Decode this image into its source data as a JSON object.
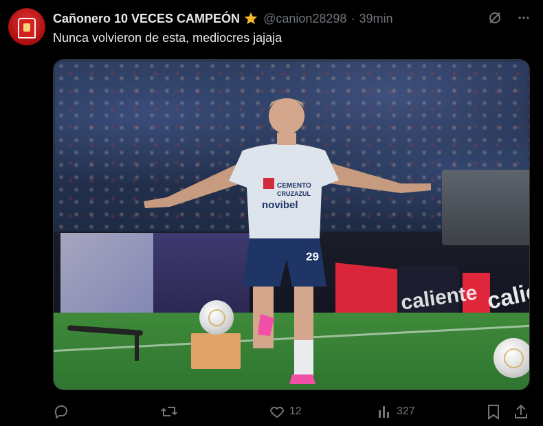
{
  "author": {
    "display_name": "Cañonero 10 VECES CAMPEÓN",
    "handle": "@canion28298",
    "separator": "·",
    "time": "39min",
    "badge_icon": "star-icon",
    "badge_color": "#f7b928"
  },
  "tweet": {
    "text": "Nunca volvieron de esta, mediocres jajaja"
  },
  "media": {
    "shirt_sponsor_1": "CEMENTO",
    "shirt_sponsor_2": "CRUZAZUL",
    "shirt_sponsor_3": "novibel",
    "shirt_number": "29",
    "board_text": "caliente"
  },
  "actions": {
    "reply_icon": "reply-icon",
    "retweet_icon": "retweet-icon",
    "like_icon": "heart-icon",
    "like_count": "12",
    "views_icon": "views-icon",
    "views_count": "327",
    "bookmark_icon": "bookmark-icon",
    "share_icon": "share-icon"
  },
  "colors": {
    "background": "#000000",
    "text_primary": "#e7e9ea",
    "text_secondary": "#71767b"
  }
}
